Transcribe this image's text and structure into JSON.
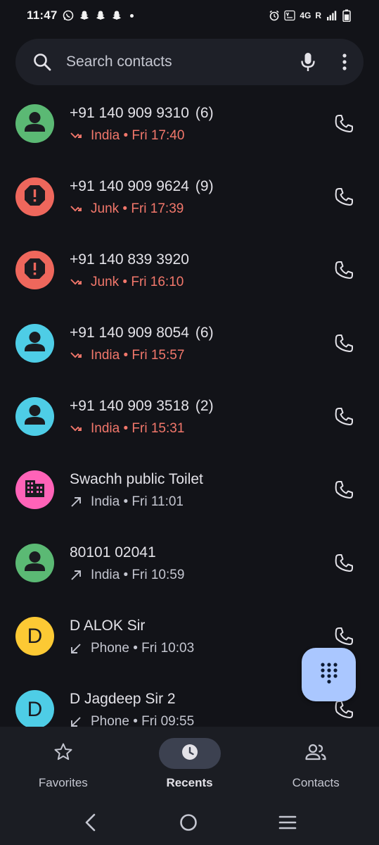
{
  "status_bar": {
    "time": "11:47",
    "network": "4G",
    "roaming": "R"
  },
  "search": {
    "placeholder": "Search contacts"
  },
  "calls": [
    {
      "title": "+91 140 909 9310",
      "count": "(6)",
      "subtitle": "India • Fri 17:40",
      "type": "missed",
      "avatar": "person",
      "avatar_color": "#5bb974"
    },
    {
      "title": "+91 140 909 9624",
      "count": "(9)",
      "subtitle": "Junk • Fri 17:39",
      "type": "missed",
      "avatar": "junk",
      "avatar_color": "#ee675c"
    },
    {
      "title": "+91 140 839 3920",
      "count": "",
      "subtitle": "Junk • Fri 16:10",
      "type": "missed",
      "avatar": "junk",
      "avatar_color": "#ee675c"
    },
    {
      "title": "+91 140 909 8054",
      "count": "(6)",
      "subtitle": "India • Fri 15:57",
      "type": "missed",
      "avatar": "person",
      "avatar_color": "#4ecde6"
    },
    {
      "title": "+91 140 909 3518",
      "count": "(2)",
      "subtitle": "India • Fri 15:31",
      "type": "missed",
      "avatar": "person",
      "avatar_color": "#4ecde6"
    },
    {
      "title": "Swachh public Toilet",
      "count": "",
      "subtitle": "India • Fri 11:01",
      "type": "outgoing",
      "avatar": "business",
      "avatar_color": "#ff63b8"
    },
    {
      "title": "80101 02041",
      "count": "",
      "subtitle": "India • Fri 10:59",
      "type": "outgoing",
      "avatar": "person",
      "avatar_color": "#5bb974"
    },
    {
      "title": "D ALOK Sir",
      "count": "",
      "subtitle": "Phone • Fri 10:03",
      "type": "incoming",
      "avatar": "letter",
      "letter": "D",
      "avatar_color": "#fcc934"
    },
    {
      "title": "D Jagdeep Sir 2",
      "count": "",
      "subtitle": "Phone • Fri 09:55",
      "type": "incoming",
      "avatar": "letter",
      "letter": "D",
      "avatar_color": "#4ecde6"
    }
  ],
  "nav": {
    "favorites": "Favorites",
    "recents": "Recents",
    "contacts": "Contacts"
  },
  "colors": {
    "accent": "#aac7ff",
    "missed": "#f2776b",
    "background": "#121318"
  }
}
